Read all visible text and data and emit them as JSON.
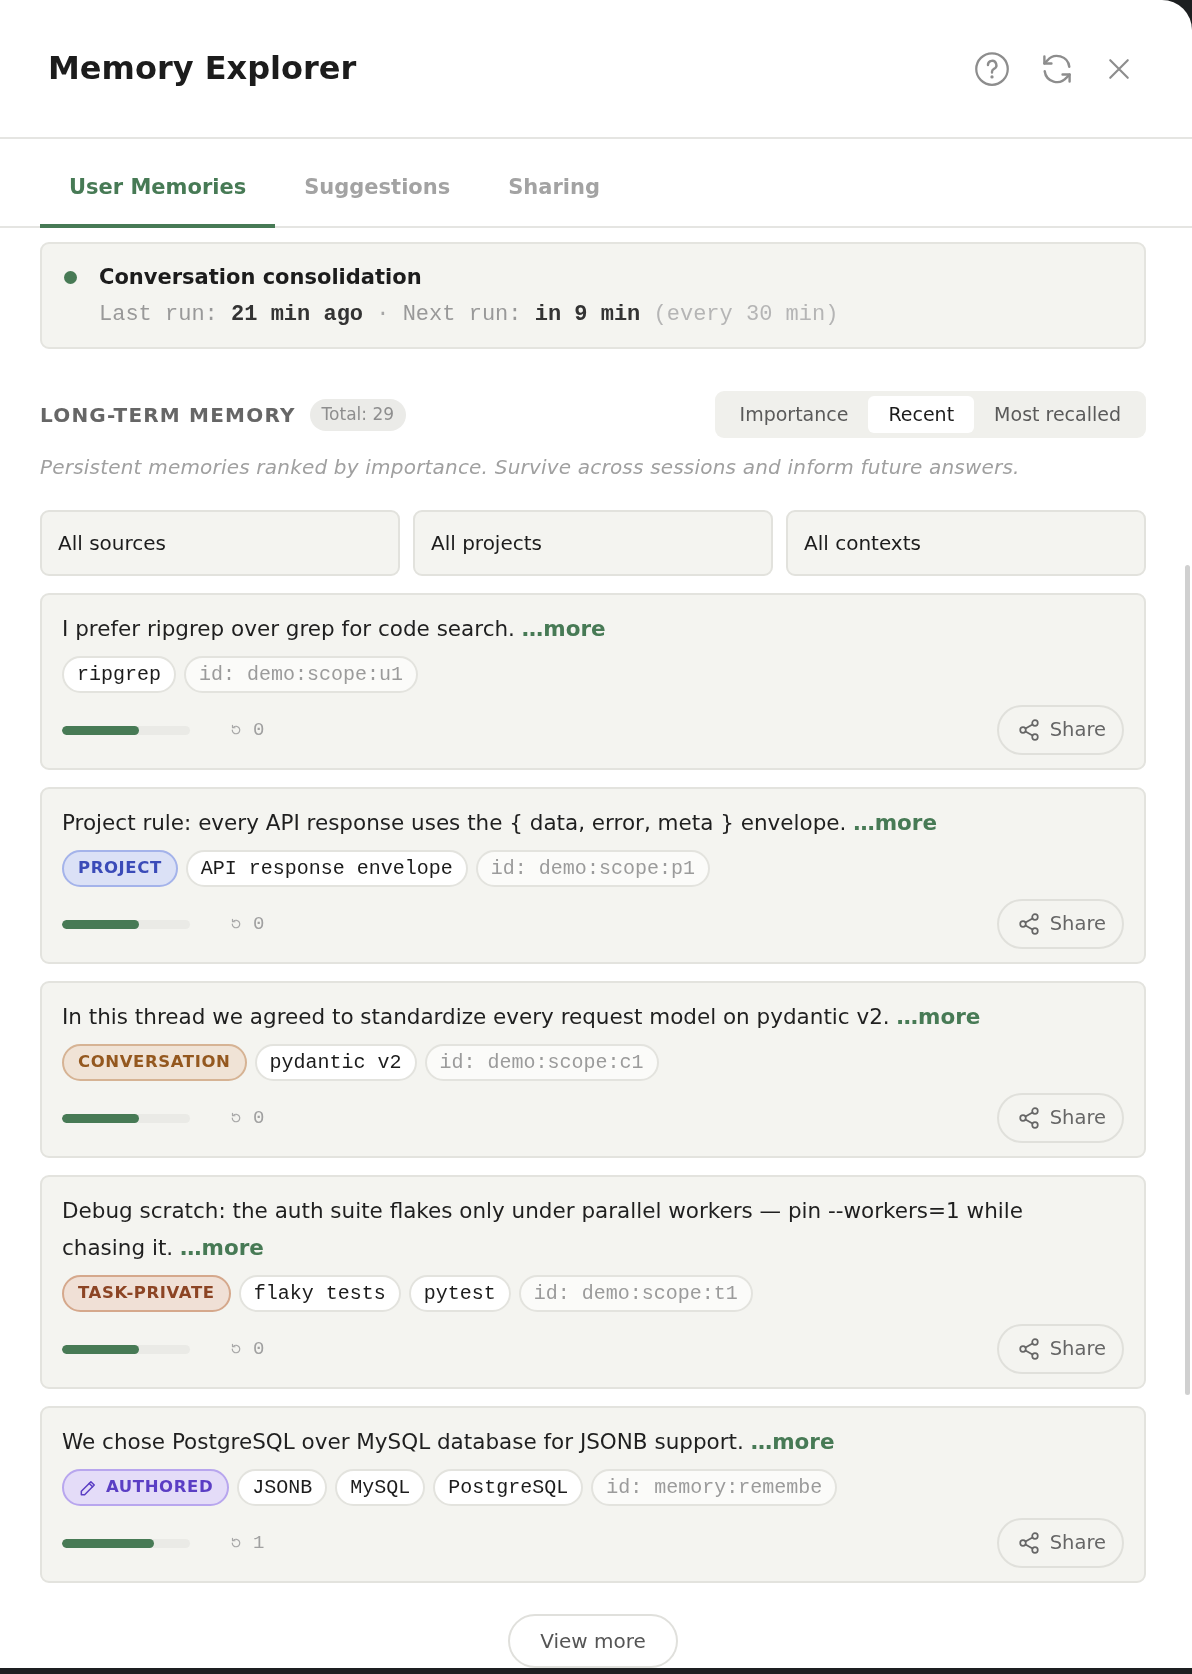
{
  "window": {
    "title": "Memory Explorer"
  },
  "tabs": [
    {
      "label": "User Memories",
      "selected": true
    },
    {
      "label": "Suggestions",
      "selected": false
    },
    {
      "label": "Sharing",
      "selected": false
    }
  ],
  "job": {
    "active": true,
    "title": "Conversation consolidation",
    "last_run_label": "Last run:",
    "last_run": "21 min ago",
    "separator": "·",
    "next_run_label": "Next run:",
    "next_run": "in 9 min",
    "interval": "(every 30 min)"
  },
  "long_term_memory": {
    "title": "LONG-TERM MEMORY",
    "total": "Total: 29",
    "sort_options": [
      {
        "label": "Importance",
        "selected": false
      },
      {
        "label": "Recent",
        "selected": true
      },
      {
        "label": "Most recalled",
        "selected": false
      }
    ],
    "description": "Persistent memories ranked by importance. Survive across sessions and inform future answers.",
    "filters": [
      {
        "value": "All sources"
      },
      {
        "value": "All projects"
      },
      {
        "value": "All contexts"
      }
    ],
    "memories": [
      {
        "text": "I prefer ripgrep over grep for code search.",
        "more": "…more",
        "tags": [
          {
            "kind": "topic",
            "label": "ripgrep"
          },
          {
            "kind": "id",
            "label": "id: demo:scope:u1"
          }
        ],
        "level": 0.6,
        "recalls": "0",
        "share": "Share"
      },
      {
        "text": "Project rule: every API response uses the { data, error, meta } envelope.",
        "more": "…more",
        "tags": [
          {
            "kind": "project",
            "label": "PROJECT"
          },
          {
            "kind": "topic",
            "label": "API response envelope"
          },
          {
            "kind": "id",
            "label": "id: demo:scope:p1"
          }
        ],
        "level": 0.6,
        "recalls": "0",
        "share": "Share"
      },
      {
        "text": "In this thread we agreed to standardize every request model on pydantic v2.",
        "more": "…more",
        "tags": [
          {
            "kind": "conversation",
            "label": "CONVERSATION"
          },
          {
            "kind": "topic",
            "label": "pydantic v2"
          },
          {
            "kind": "id",
            "label": "id: demo:scope:c1"
          }
        ],
        "level": 0.6,
        "recalls": "0",
        "share": "Share"
      },
      {
        "text": "Debug scratch: the auth suite flakes only under parallel workers — pin --workers=1 while chasing it.",
        "more": "…more",
        "tags": [
          {
            "kind": "task",
            "label": "TASK-PRIVATE"
          },
          {
            "kind": "topic",
            "label": "flaky tests"
          },
          {
            "kind": "topic",
            "label": "pytest"
          },
          {
            "kind": "id",
            "label": "id: demo:scope:t1"
          }
        ],
        "level": 0.6,
        "recalls": "0",
        "share": "Share"
      },
      {
        "text": "We chose PostgreSQL over MySQL database for JSONB support.",
        "more": "…more",
        "tags": [
          {
            "kind": "authored",
            "label": "AUTHORED"
          },
          {
            "kind": "topic",
            "label": "JSONB"
          },
          {
            "kind": "topic",
            "label": "MySQL"
          },
          {
            "kind": "topic",
            "label": "PostgreSQL"
          },
          {
            "kind": "id",
            "label": "id: memory:remembe"
          }
        ],
        "level": 0.72,
        "recalls": "1",
        "share": "Share"
      }
    ],
    "view_more": "View more"
  }
}
